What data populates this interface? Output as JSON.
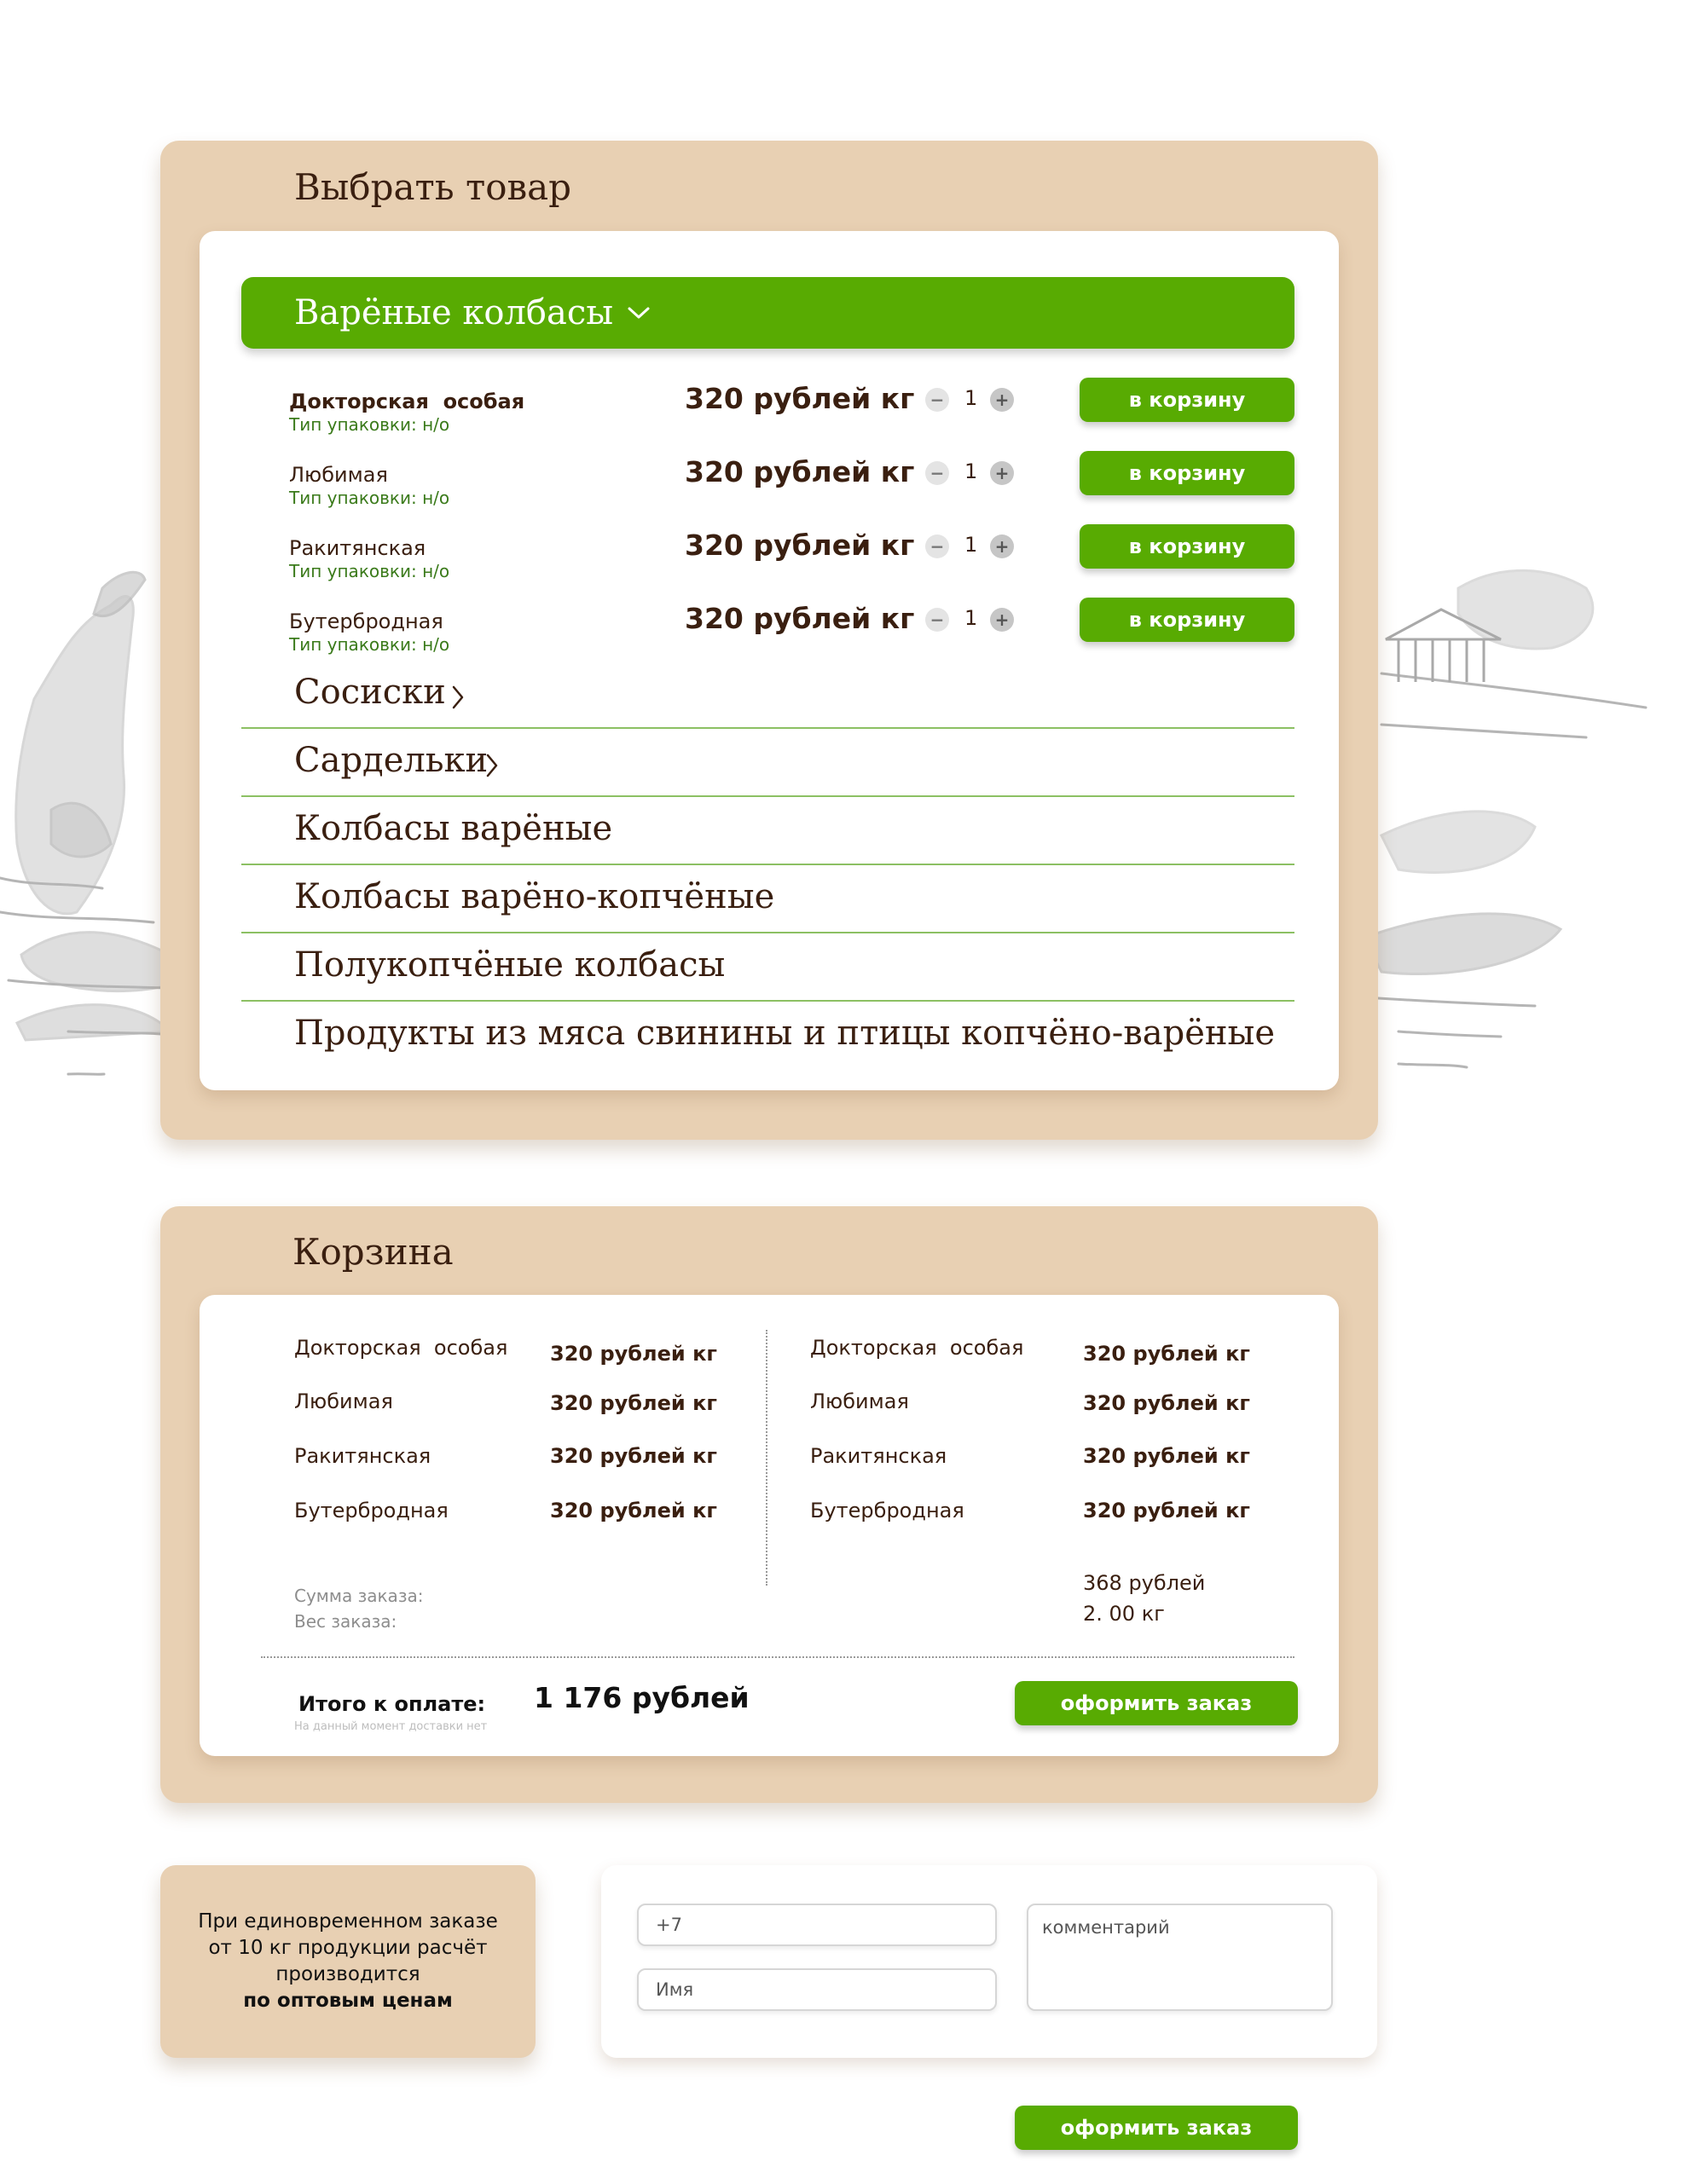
{
  "select_section": {
    "title": "Выбрать товар",
    "active_category": "Варёные колбасы",
    "products": [
      {
        "name": "Докторская  особая",
        "pack": "Тип упаковки: н/о",
        "price": "320 рублей кг",
        "qty": "1",
        "button": "в корзину"
      },
      {
        "name": "Любимая",
        "pack": "Тип упаковки: н/о",
        "price": "320 рублей кг",
        "qty": "1",
        "button": "в корзину"
      },
      {
        "name": "Ракитянская",
        "pack": "Тип упаковки: н/о",
        "price": "320 рублей кг",
        "qty": "1",
        "button": "в корзину"
      },
      {
        "name": "Бутербродная",
        "pack": "Тип упаковки: н/о",
        "price": "320 рублей кг",
        "qty": "1",
        "button": "в корзину"
      }
    ],
    "categories": [
      "Сосиски",
      "Сардельки",
      "Колбасы варёные",
      "Колбасы варёно-копчёные",
      "Полукопчёные колбасы",
      "Продукты из мяса свинины и птицы копчёно-варёные"
    ]
  },
  "basket": {
    "title": "Корзина",
    "left_items": [
      {
        "name": "Докторская  особая",
        "price": "320 рублей кг"
      },
      {
        "name": "Любимая",
        "price": "320 рублей кг"
      },
      {
        "name": "Ракитянская",
        "price": "320 рублей кг"
      },
      {
        "name": "Бутербродная",
        "price": "320 рублей кг"
      }
    ],
    "right_items": [
      {
        "name": "Докторская  особая",
        "price": "320 рублей кг"
      },
      {
        "name": "Любимая",
        "price": "320 рублей кг"
      },
      {
        "name": "Ракитянская",
        "price": "320 рублей кг"
      },
      {
        "name": "Бутербродная",
        "price": "320 рублей кг"
      }
    ],
    "sum_label": "Сумма заказа:",
    "weight_label": "Вес заказа:",
    "sum_value": "368 рублей",
    "weight_value": "2. 00 кг",
    "total_label": "Итого к оплате:",
    "total_value": "1 176 рублей",
    "delivery_note": "На данный момент доставки нет",
    "order_button": "оформить заказ"
  },
  "info_box": {
    "line1": "При единовременном заказе",
    "line2": "от 10 кг продукции расчёт",
    "line3": "производится",
    "line4": "по оптовым ценам"
  },
  "form": {
    "phone_placeholder": "+7",
    "name_placeholder": "Имя",
    "comment_placeholder": "комментарий",
    "submit_button": "оформить заказ"
  },
  "colors": {
    "beige": "#e8d0b3",
    "green": "#58ab02",
    "brown_text": "#3a1f10",
    "pack_text": "#3a7a1a",
    "divider": "#8cc063"
  },
  "icons": {
    "dropdown": "chevron-down-icon",
    "category": "chevron-right-icon",
    "minus": "minus-icon",
    "plus": "plus-icon"
  }
}
